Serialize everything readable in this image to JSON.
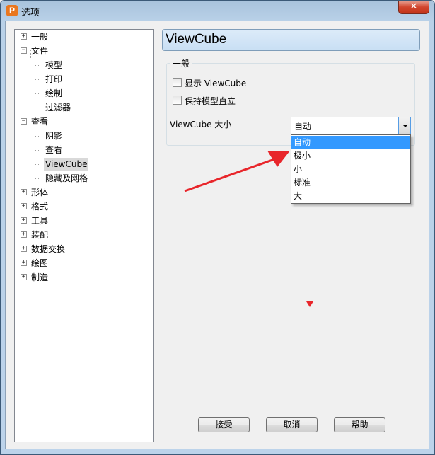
{
  "window": {
    "title": "选项",
    "app_icon_letter": "P",
    "close_glyph": "✕"
  },
  "tree": {
    "items": [
      {
        "label": "一般",
        "expander": "+"
      },
      {
        "label": "文件",
        "expander": "−"
      },
      {
        "label": "模型"
      },
      {
        "label": "打印"
      },
      {
        "label": "绘制"
      },
      {
        "label": "过滤器"
      },
      {
        "label": "查看",
        "expander": "−"
      },
      {
        "label": "阴影"
      },
      {
        "label": "查看"
      },
      {
        "label": "ViewCube",
        "selected": true
      },
      {
        "label": "隐藏及网格"
      },
      {
        "label": "形体",
        "expander": "+"
      },
      {
        "label": "格式",
        "expander": "+"
      },
      {
        "label": "工具",
        "expander": "+"
      },
      {
        "label": "装配",
        "expander": "+"
      },
      {
        "label": "数据交换",
        "expander": "+"
      },
      {
        "label": "绘图",
        "expander": "+"
      },
      {
        "label": "制造",
        "expander": "+"
      }
    ]
  },
  "panel": {
    "title": "ViewCube",
    "group_title": "一般",
    "show_viewcube_label": "显示 ViewCube",
    "keep_upright_label": "保持模型直立",
    "size_label": "ViewCube 大小",
    "size_value": "自动",
    "size_options": [
      "自动",
      "极小",
      "小",
      "标准",
      "大"
    ],
    "highlighted_option": 0
  },
  "buttons": {
    "ok": "接受",
    "cancel": "取消",
    "help": "帮助"
  },
  "annotation": {
    "arrow_color": "#e8262b"
  },
  "colors": {
    "selection_blue": "#3399ff",
    "close_red": "#c23418"
  }
}
